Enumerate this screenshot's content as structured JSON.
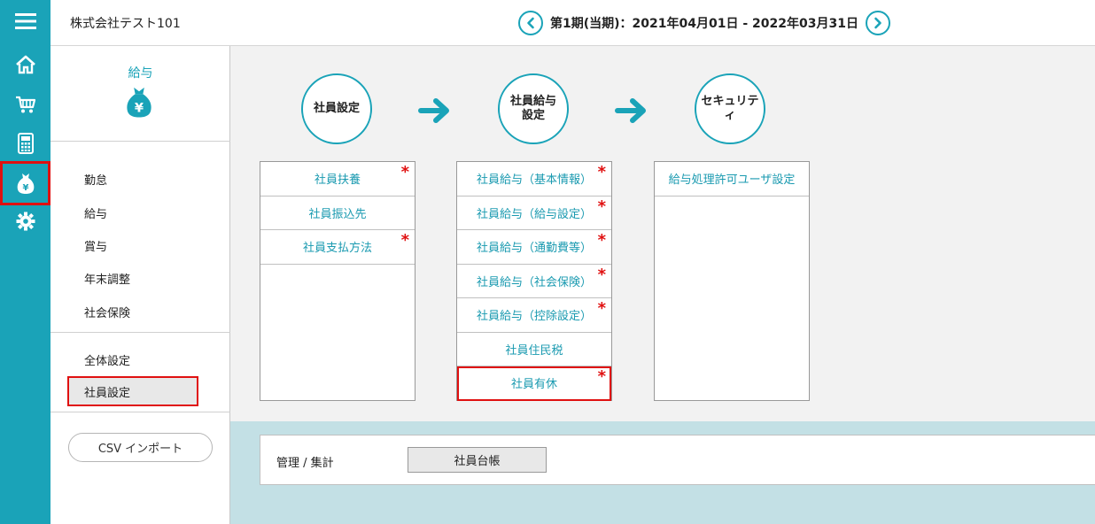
{
  "header": {
    "company": "株式会社テスト101",
    "period": "第1期(当期)：2021年04月01日 - 2022年03月31日"
  },
  "rail": {
    "icons": [
      "menu-icon",
      "home-icon",
      "cart-icon",
      "calculator-icon",
      "money-bag-icon",
      "gear-icon"
    ],
    "accent": "#1aa3b8"
  },
  "submenu": {
    "title": "給与",
    "items": [
      "勤怠",
      "給与",
      "賞与",
      "年末調整",
      "社会保険"
    ],
    "settings": [
      "全体設定",
      "社員設定"
    ],
    "active": "社員設定",
    "csv_button": "CSV インポート"
  },
  "steps": [
    "社員設定",
    "社員給与\n設定",
    "セキュリティ"
  ],
  "columns": [
    {
      "items": [
        {
          "label": "社員扶養",
          "required": true
        },
        {
          "label": "社員振込先",
          "required": false
        },
        {
          "label": "社員支払方法",
          "required": true
        }
      ]
    },
    {
      "items": [
        {
          "label": "社員給与（基本情報）",
          "required": true
        },
        {
          "label": "社員給与（給与設定）",
          "required": true
        },
        {
          "label": "社員給与（通勤費等）",
          "required": true
        },
        {
          "label": "社員給与（社会保険）",
          "required": true
        },
        {
          "label": "社員給与（控除設定）",
          "required": true
        },
        {
          "label": "社員住民税",
          "required": false
        },
        {
          "label": "社員有休",
          "required": true,
          "highlighted": true
        }
      ]
    },
    {
      "items": [
        {
          "label": "給与処理許可ユーザ設定",
          "required": false
        }
      ]
    }
  ],
  "required_mark": "*",
  "summary": {
    "label": "管理 / 集計",
    "button": "社員台帳"
  }
}
